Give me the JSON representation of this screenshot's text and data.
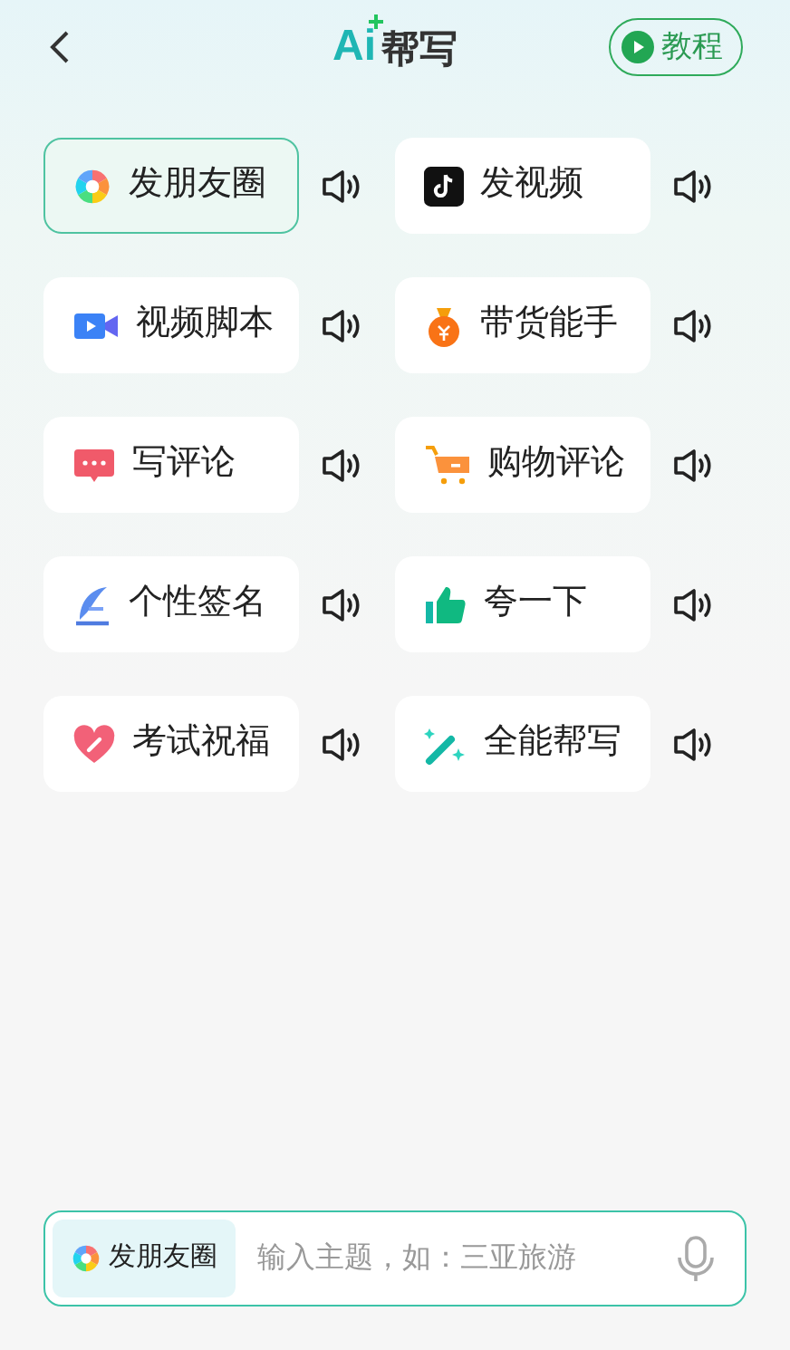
{
  "header": {
    "logo_ai": "Ai",
    "logo_text": "帮写",
    "tutorial_button": "教程"
  },
  "tools": [
    {
      "label": "发朋友圈",
      "kind": "moments",
      "selected": true
    },
    {
      "label": "发视频",
      "kind": "video",
      "selected": false
    },
    {
      "label": "视频脚本",
      "kind": "camera",
      "selected": false
    },
    {
      "label": "带货能手",
      "kind": "moneybag",
      "selected": false
    },
    {
      "label": "写评论",
      "kind": "comment",
      "selected": false
    },
    {
      "label": "购物评论",
      "kind": "cart",
      "selected": false
    },
    {
      "label": "个性签名",
      "kind": "signature",
      "selected": false
    },
    {
      "label": "夸一下",
      "kind": "thumb",
      "selected": false
    },
    {
      "label": "考试祝福",
      "kind": "heart",
      "selected": false
    },
    {
      "label": "全能帮写",
      "kind": "wand",
      "selected": false
    }
  ],
  "input_bar": {
    "chip": {
      "label": "发朋友圈",
      "kind": "moments"
    },
    "placeholder": "输入主题，如：三亚旅游"
  }
}
